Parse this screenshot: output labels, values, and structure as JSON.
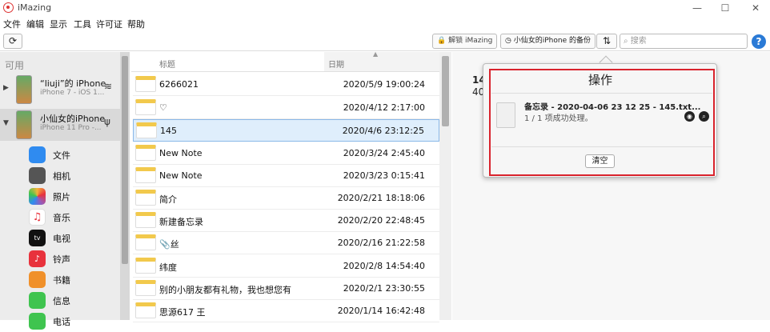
{
  "window": {
    "title": "iMazing",
    "min": "—",
    "max": "☐",
    "close": "✕"
  },
  "menu": [
    "文件",
    "编辑",
    "显示",
    "工具",
    "许可证",
    "帮助"
  ],
  "toolbar": {
    "refresh": "⟳",
    "unlock_label": "解锁 iMazing",
    "backup_label": "小仙女的iPhone 的备份",
    "transfer_icon": "⇅",
    "search_placeholder": "搜索",
    "help": "?"
  },
  "sidebar": {
    "section_label": "可用",
    "devices": [
      {
        "name": "“liuji”的 iPhone",
        "subtitle": "iPhone 7 - iOS 1...",
        "status": "wifi-icon"
      },
      {
        "name": "小仙女的iPhone",
        "subtitle": "iPhone 11 Pro -...",
        "status": "usb-icon"
      }
    ],
    "apps": [
      {
        "label": "文件",
        "color": "#2f8bf0"
      },
      {
        "label": "相机",
        "color": "#555555"
      },
      {
        "label": "照片",
        "color": "#f5b43a"
      },
      {
        "label": "音乐",
        "color": "#ffffff"
      },
      {
        "label": "电视",
        "color": "#111111"
      },
      {
        "label": "铃声",
        "color": "#e8323c"
      },
      {
        "label": "书籍",
        "color": "#f0902a"
      },
      {
        "label": "信息",
        "color": "#3fc44f"
      },
      {
        "label": "电话",
        "color": "#3fc44f"
      }
    ]
  },
  "list": {
    "header_title": "标题",
    "header_date": "日期",
    "rows": [
      {
        "title": "6266021",
        "date": "2020/5/9 19:00:24"
      },
      {
        "title": "♡",
        "date": "2020/4/12 2:17:00"
      },
      {
        "title": "145",
        "date": "2020/4/6 23:12:25",
        "selected": true
      },
      {
        "title": "New Note",
        "date": "2020/3/24 2:45:40"
      },
      {
        "title": "New Note",
        "date": "2020/3/23 0:15:41"
      },
      {
        "title": "简介",
        "date": "2020/2/21 18:18:06"
      },
      {
        "title": "新建备忘录",
        "date": "2020/2/20 22:48:45"
      },
      {
        "title": "📎丝",
        "date": "2020/2/16 21:22:58"
      },
      {
        "title": "纬度",
        "date": "2020/2/8 14:54:40"
      },
      {
        "title": "别的小朋友都有礼物，我也想您有",
        "date": "2020/2/1 23:30:55"
      },
      {
        "title": "思源617 王",
        "date": "2020/1/14 16:42:48"
      }
    ]
  },
  "detail": {
    "title": "14",
    "size": "40"
  },
  "popover": {
    "title": "操作",
    "file_name": "备忘录 - 2020-04-06 23 12 25 - 145.txt...",
    "status": "1 / 1 项成功处理。",
    "clear_label": "清空"
  }
}
